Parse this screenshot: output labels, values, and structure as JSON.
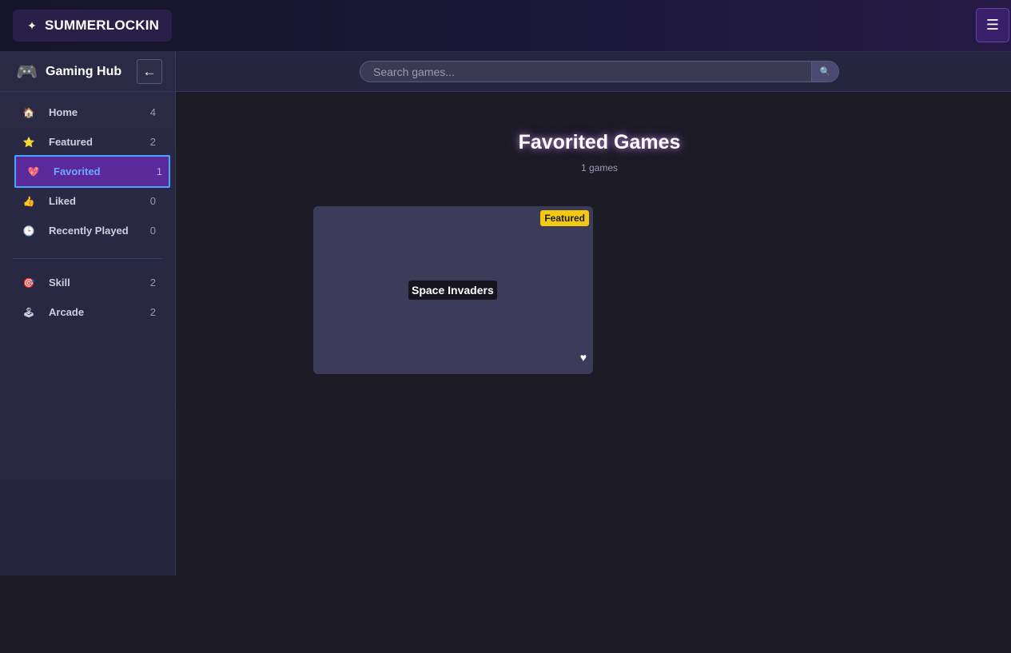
{
  "brand": {
    "icon": "sparkle-icon",
    "title": "SUMMERLOCKIN"
  },
  "header": {
    "menu_icon": "☰"
  },
  "sidebar": {
    "title": "Gaming Hub",
    "collapse_icon": "←",
    "items": [
      {
        "icon": "house-icon",
        "glyph": "🏠",
        "label": "Home",
        "count": "4"
      },
      {
        "icon": "star-icon",
        "glyph": "⭐",
        "label": "Featured",
        "count": "2"
      },
      {
        "icon": "heart-icon",
        "glyph": "💖",
        "label": "Favorited",
        "count": "1",
        "active": true
      },
      {
        "icon": "thumbs-up-icon",
        "glyph": "👍",
        "label": "Liked",
        "count": "0"
      },
      {
        "icon": "clock-icon",
        "glyph": "🕒",
        "label": "Recently Played",
        "count": "0"
      }
    ],
    "categories": [
      {
        "icon": "target-icon",
        "glyph": "🎯",
        "label": "Skill",
        "count": "2"
      },
      {
        "icon": "joystick-icon",
        "glyph": "🕹",
        "label": "Arcade",
        "count": "2"
      }
    ]
  },
  "search": {
    "placeholder": "Search games...",
    "value": ""
  },
  "main": {
    "title": "Favorited Games",
    "subtitle": "1 games",
    "games": [
      {
        "title": "Space Invaders",
        "badge": "Featured",
        "favorited": true
      }
    ]
  },
  "colors": {
    "accent": "#5a2a9a",
    "highlight_border": "#4aa3ff",
    "badge": "#f2c811",
    "background": "#1c1b26"
  }
}
